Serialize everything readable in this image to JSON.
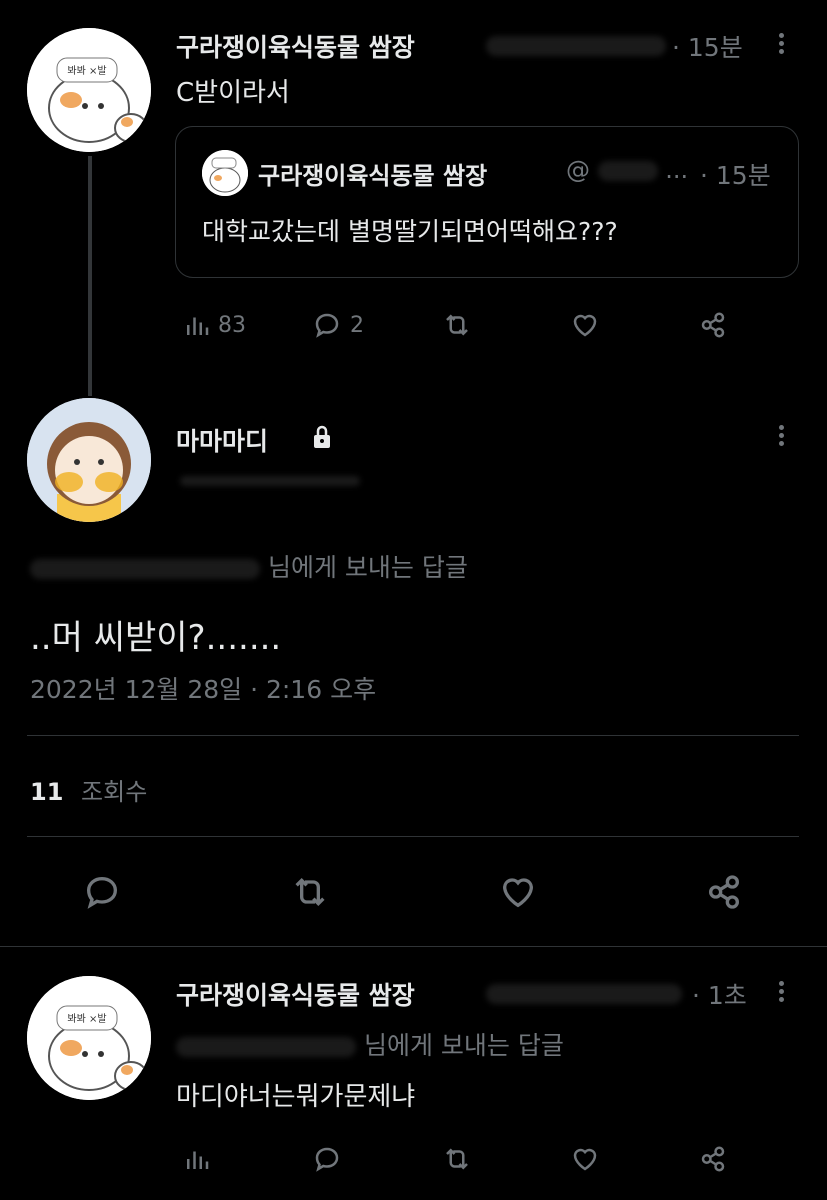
{
  "thread": {
    "parent": {
      "author_name": "구라쟁이육식동물 쌈장",
      "time": "· 15분",
      "text": "C받이라서",
      "quote": {
        "author_name": "구라쟁이육식동물 쌈장",
        "handle_hint": "@",
        "handle_tail": "...",
        "time": "· 15분",
        "text": "대학교갔는데 별명딸기되면어떡해요???"
      },
      "stats": {
        "views": "83",
        "replies": "2"
      }
    },
    "main": {
      "author_name": "마마마디",
      "reply_to_suffix": "님에게 보내는 답글",
      "text": "..머 씨받이?.......",
      "timestamp": "2022년 12월 28일 · 2:16 오후",
      "views_count": "11",
      "views_label": "조회수"
    },
    "reply": {
      "author_name": "구라쟁이육식동물 쌈장",
      "time": "· 1초",
      "reply_to_suffix": "님에게 보내는 답글",
      "text": "마디야너는뭐가문제냐"
    }
  },
  "avatar_text": {
    "hamster_sign": "봐봐 ×발"
  },
  "icons": [
    "analytics-icon",
    "reply-icon",
    "retweet-icon",
    "like-icon",
    "share-icon",
    "more-icon",
    "lock-icon"
  ],
  "colors": {
    "background": "#000000",
    "text": "#e7e9ea",
    "muted": "#71767b",
    "border": "#2f3336"
  }
}
